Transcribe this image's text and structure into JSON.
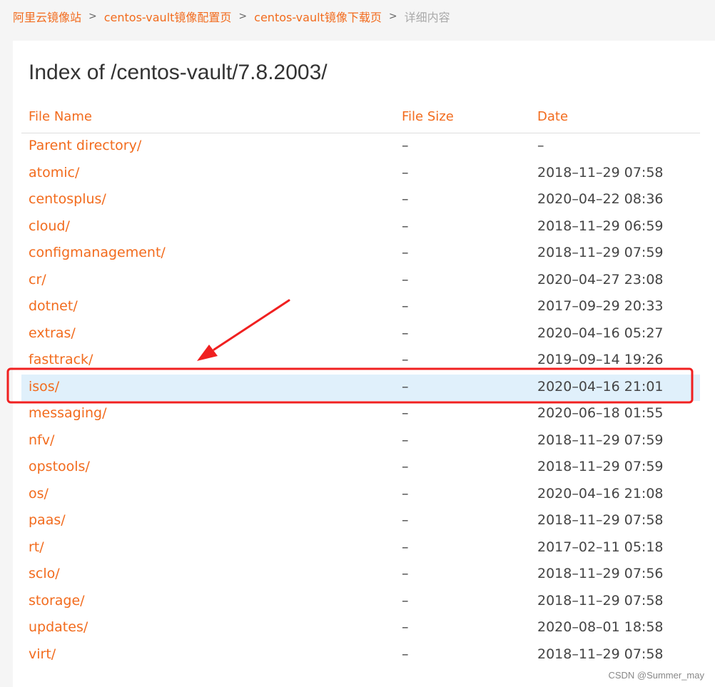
{
  "breadcrumb": {
    "items": [
      "阿里云镜像站",
      "centos-vault镜像配置页",
      "centos-vault镜像下载页"
    ],
    "current": "详细内容",
    "separator": ">"
  },
  "title": "Index of /centos-vault/7.8.2003/",
  "table": {
    "headers": {
      "name": "File Name",
      "size": "File Size",
      "date": "Date"
    },
    "rows": [
      {
        "name": "Parent directory/",
        "size": "–",
        "date": "–"
      },
      {
        "name": "atomic/",
        "size": "–",
        "date": "2018–11–29 07:58"
      },
      {
        "name": "centosplus/",
        "size": "–",
        "date": "2020–04–22 08:36"
      },
      {
        "name": "cloud/",
        "size": "–",
        "date": "2018–11–29 06:59"
      },
      {
        "name": "configmanagement/",
        "size": "–",
        "date": "2018–11–29 07:59"
      },
      {
        "name": "cr/",
        "size": "–",
        "date": "2020–04–27 23:08"
      },
      {
        "name": "dotnet/",
        "size": "–",
        "date": "2017–09–29 20:33"
      },
      {
        "name": "extras/",
        "size": "–",
        "date": "2020–04–16 05:27"
      },
      {
        "name": "fasttrack/",
        "size": "–",
        "date": "2019–09–14 19:26"
      },
      {
        "name": "isos/",
        "size": "–",
        "date": "2020–04–16 21:01"
      },
      {
        "name": "messaging/",
        "size": "–",
        "date": "2020–06–18 01:55"
      },
      {
        "name": "nfv/",
        "size": "–",
        "date": "2018–11–29 07:59"
      },
      {
        "name": "opstools/",
        "size": "–",
        "date": "2018–11–29 07:59"
      },
      {
        "name": "os/",
        "size": "–",
        "date": "2020–04–16 21:08"
      },
      {
        "name": "paas/",
        "size": "–",
        "date": "2018–11–29 07:58"
      },
      {
        "name": "rt/",
        "size": "–",
        "date": "2017–02–11 05:18"
      },
      {
        "name": "sclo/",
        "size": "–",
        "date": "2018–11–29 07:56"
      },
      {
        "name": "storage/",
        "size": "–",
        "date": "2018–11–29 07:58"
      },
      {
        "name": "updates/",
        "size": "–",
        "date": "2020–08–01 18:58"
      },
      {
        "name": "virt/",
        "size": "–",
        "date": "2018–11–29 07:58"
      }
    ],
    "highlighted_row": "isos/"
  },
  "annotation": {
    "shape": "red-box-and-arrow",
    "color": "#f02020",
    "target": "isos/"
  },
  "colors": {
    "link": "#f26b1d",
    "highlight_bg": "#e0f0fb",
    "page_bg": "#f5f5f5"
  },
  "watermark": "CSDN @Summer_may"
}
